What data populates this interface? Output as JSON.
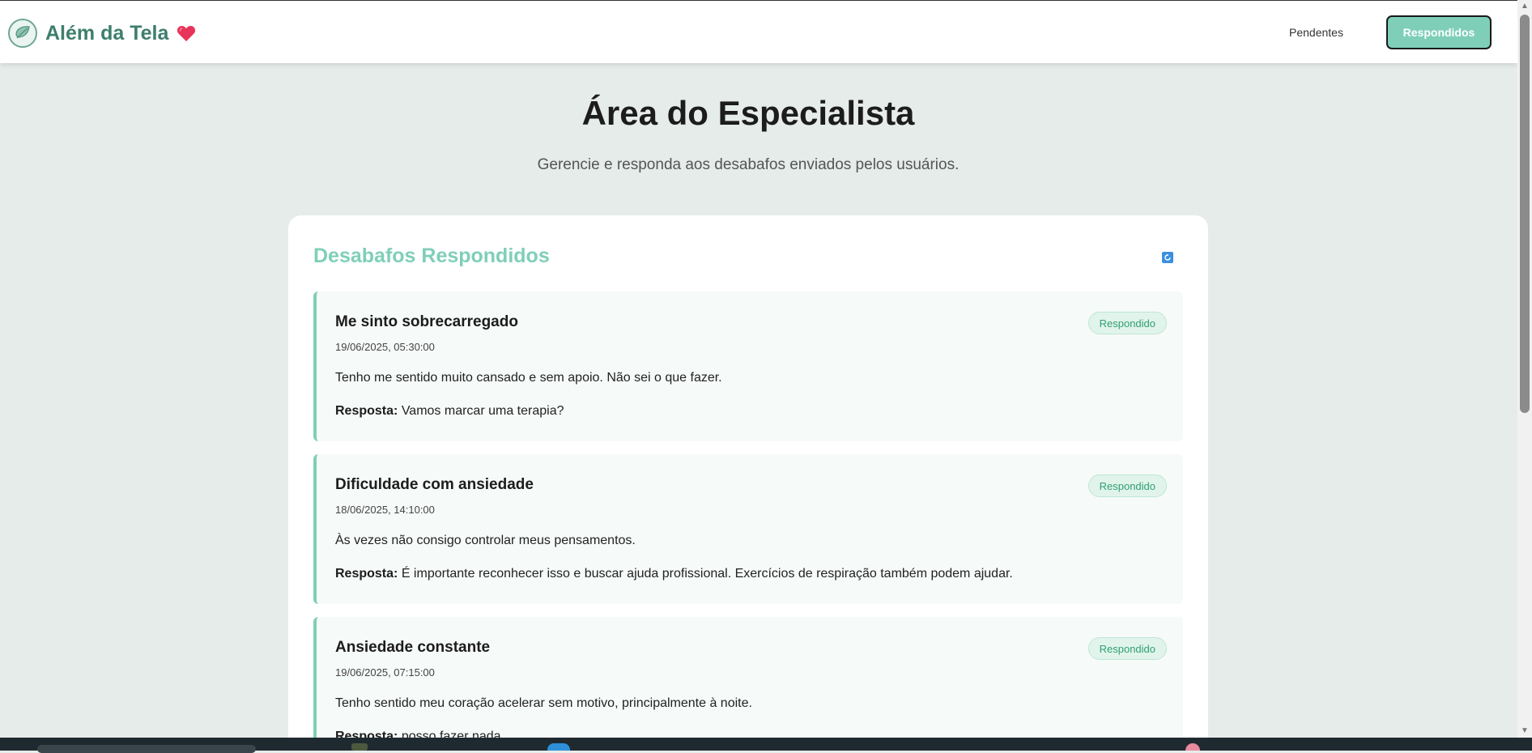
{
  "header": {
    "brand_name": "Além da Tela",
    "nav_pending": "Pendentes",
    "nav_answered": "Respondidos"
  },
  "page": {
    "title": "Área do Especialista",
    "subtitle": "Gerencie e responda aos desabafos enviados pelos usuários."
  },
  "panel": {
    "title": "Desabafos Respondidos",
    "answer_label": "Resposta:",
    "items": [
      {
        "title": "Me sinto sobrecarregado",
        "date": "19/06/2025, 05:30:00",
        "text": "Tenho me sentido muito cansado e sem apoio. Não sei o que fazer.",
        "answer": "Vamos marcar uma terapia?",
        "status": "Respondido"
      },
      {
        "title": "Dificuldade com ansiedade",
        "date": "18/06/2025, 14:10:00",
        "text": "Às vezes não consigo controlar meus pensamentos.",
        "answer": "É importante reconhecer isso e buscar ajuda profissional. Exercícios de respiração também podem ajudar.",
        "status": "Respondido"
      },
      {
        "title": "Ansiedade constante",
        "date": "19/06/2025, 07:15:00",
        "text": "Tenho sentido meu coração acelerar sem motivo, principalmente à noite.",
        "answer": "posso fazer nada",
        "status": "Respondido"
      }
    ]
  },
  "colors": {
    "accent": "#7fcfb8",
    "brand": "#3e7e6c",
    "background": "#e6ece9",
    "badge_text": "#2f9f72"
  },
  "icons": {
    "logo": "leaf-logo-icon",
    "heart": "heart-icon",
    "refresh": "refresh-icon"
  }
}
